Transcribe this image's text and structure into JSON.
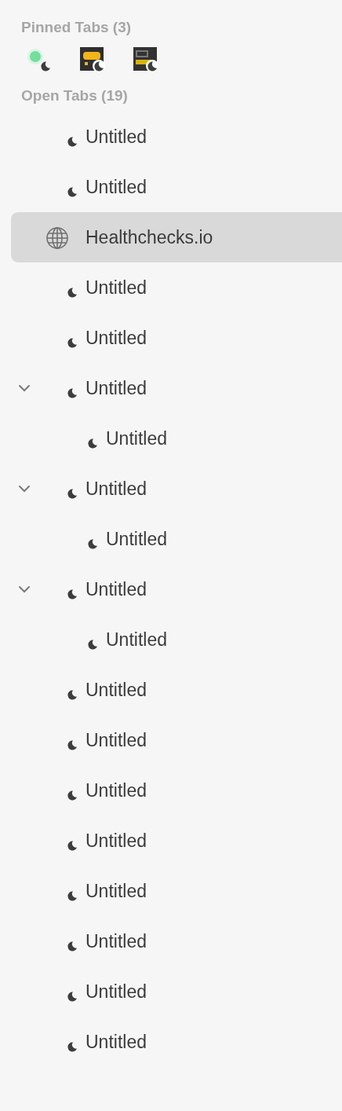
{
  "pinned_heading": "Pinned Tabs (3)",
  "pinned_tabs": [
    {
      "kind": "blob",
      "sleeping": true
    },
    {
      "kind": "robot",
      "sleeping": true
    },
    {
      "kind": "vnc",
      "sleeping": true
    }
  ],
  "open_heading": "Open Tabs (19)",
  "tabs": [
    {
      "title": "Untitled",
      "kind": "sleeping",
      "selected": false
    },
    {
      "title": "Untitled",
      "kind": "sleeping",
      "selected": false
    },
    {
      "title": "Healthchecks.io",
      "kind": "site",
      "selected": true
    },
    {
      "title": "Untitled",
      "kind": "sleeping",
      "selected": false
    },
    {
      "title": "Untitled",
      "kind": "sleeping",
      "selected": false
    },
    {
      "title": "Untitled",
      "kind": "sleeping",
      "selected": false,
      "expanded": true,
      "children": [
        {
          "title": "Untitled",
          "kind": "sleeping",
          "selected": false
        }
      ]
    },
    {
      "title": "Untitled",
      "kind": "sleeping",
      "selected": false,
      "expanded": true,
      "children": [
        {
          "title": "Untitled",
          "kind": "sleeping",
          "selected": false
        }
      ]
    },
    {
      "title": "Untitled",
      "kind": "sleeping",
      "selected": false,
      "expanded": true,
      "children": [
        {
          "title": "Untitled",
          "kind": "sleeping",
          "selected": false
        }
      ]
    },
    {
      "title": "Untitled",
      "kind": "sleeping",
      "selected": false
    },
    {
      "title": "Untitled",
      "kind": "sleeping",
      "selected": false
    },
    {
      "title": "Untitled",
      "kind": "sleeping",
      "selected": false
    },
    {
      "title": "Untitled",
      "kind": "sleeping",
      "selected": false
    },
    {
      "title": "Untitled",
      "kind": "sleeping",
      "selected": false
    },
    {
      "title": "Untitled",
      "kind": "sleeping",
      "selected": false
    },
    {
      "title": "Untitled",
      "kind": "sleeping",
      "selected": false
    },
    {
      "title": "Untitled",
      "kind": "sleeping",
      "selected": false
    }
  ]
}
